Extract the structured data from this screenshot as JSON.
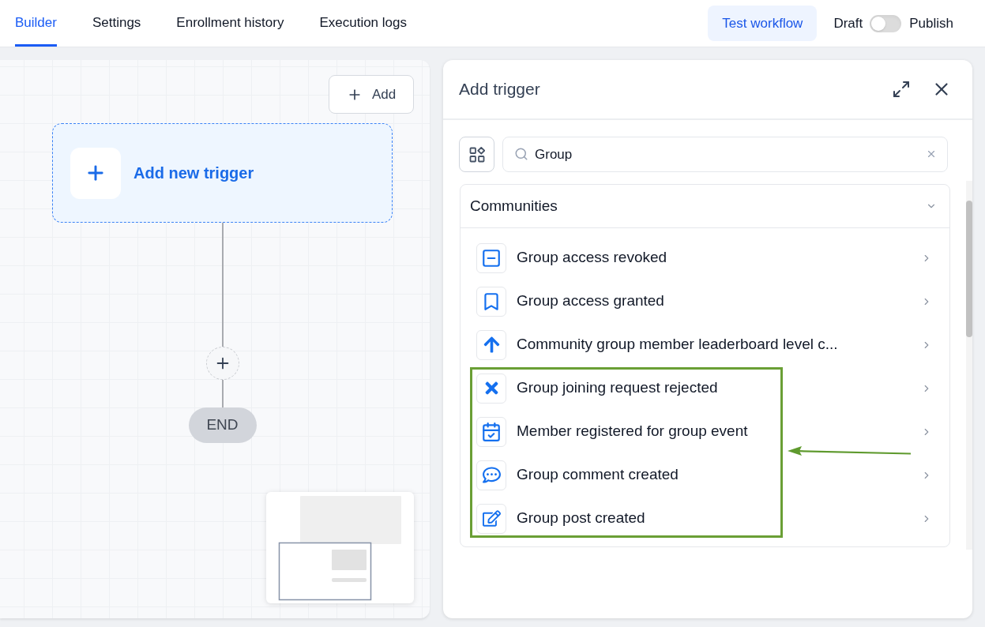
{
  "tabs": [
    {
      "label": "Builder",
      "selected": true
    },
    {
      "label": "Settings",
      "selected": false
    },
    {
      "label": "Enrollment history",
      "selected": false
    },
    {
      "label": "Execution logs",
      "selected": false
    }
  ],
  "test_button": {
    "label": "Test workflow"
  },
  "publish_toggle": {
    "off_label": "Draft",
    "on_label": "Publish",
    "on": false
  },
  "canvas": {
    "add_button": {
      "label": "Add"
    },
    "trigger_node": {
      "label": "Add new trigger"
    },
    "end_node": {
      "label": "END"
    }
  },
  "trigger_panel": {
    "title": "Add trigger",
    "search": {
      "value": "Group"
    },
    "groups": [
      {
        "title": "Communities",
        "expanded": true,
        "items": [
          {
            "label": "Group access revoked",
            "highlighted": false
          },
          {
            "label": "Group access granted",
            "highlighted": false
          },
          {
            "label": "Community group member leaderboard level c...",
            "highlighted": false
          },
          {
            "label": "Group joining request rejected",
            "highlighted": true
          },
          {
            "label": "Member registered for group event",
            "highlighted": true
          },
          {
            "label": "Group comment created",
            "highlighted": true
          },
          {
            "label": "Group post created",
            "highlighted": true
          }
        ]
      }
    ]
  }
}
